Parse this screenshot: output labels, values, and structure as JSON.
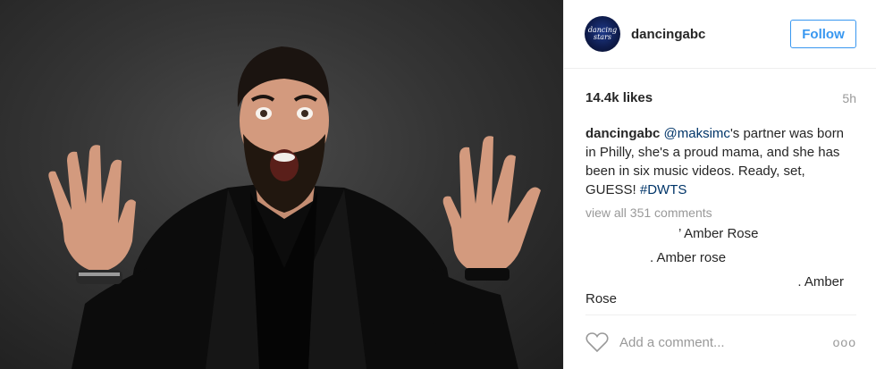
{
  "post": {
    "photo_icon": "man-with-raised-hands-photo",
    "header": {
      "avatar_text": "dancing stars",
      "username": "dancingabc",
      "follow_label": "Follow"
    },
    "likes": "14.4k likes",
    "time": "5h",
    "caption": {
      "author": "dancingabc",
      "mention": "@maksimc",
      "text": "'s partner was born in Philly, she's a proud mama, and she has been in six music videos. Ready, set, GUESS! ",
      "hashtag": "#DWTS"
    },
    "view_all": "view all 351 comments",
    "comments": [
      {
        "text": "’ Amber Rose"
      },
      {
        "text": ". Amber rose"
      },
      {
        "text": ". Amber"
      },
      {
        "text": "Rose"
      }
    ],
    "add_comment_placeholder": "Add a comment...",
    "more_label": "ooo",
    "colors": {
      "link": "#003569",
      "follow": "#3897f0",
      "muted": "#999999",
      "text": "#262626"
    }
  }
}
